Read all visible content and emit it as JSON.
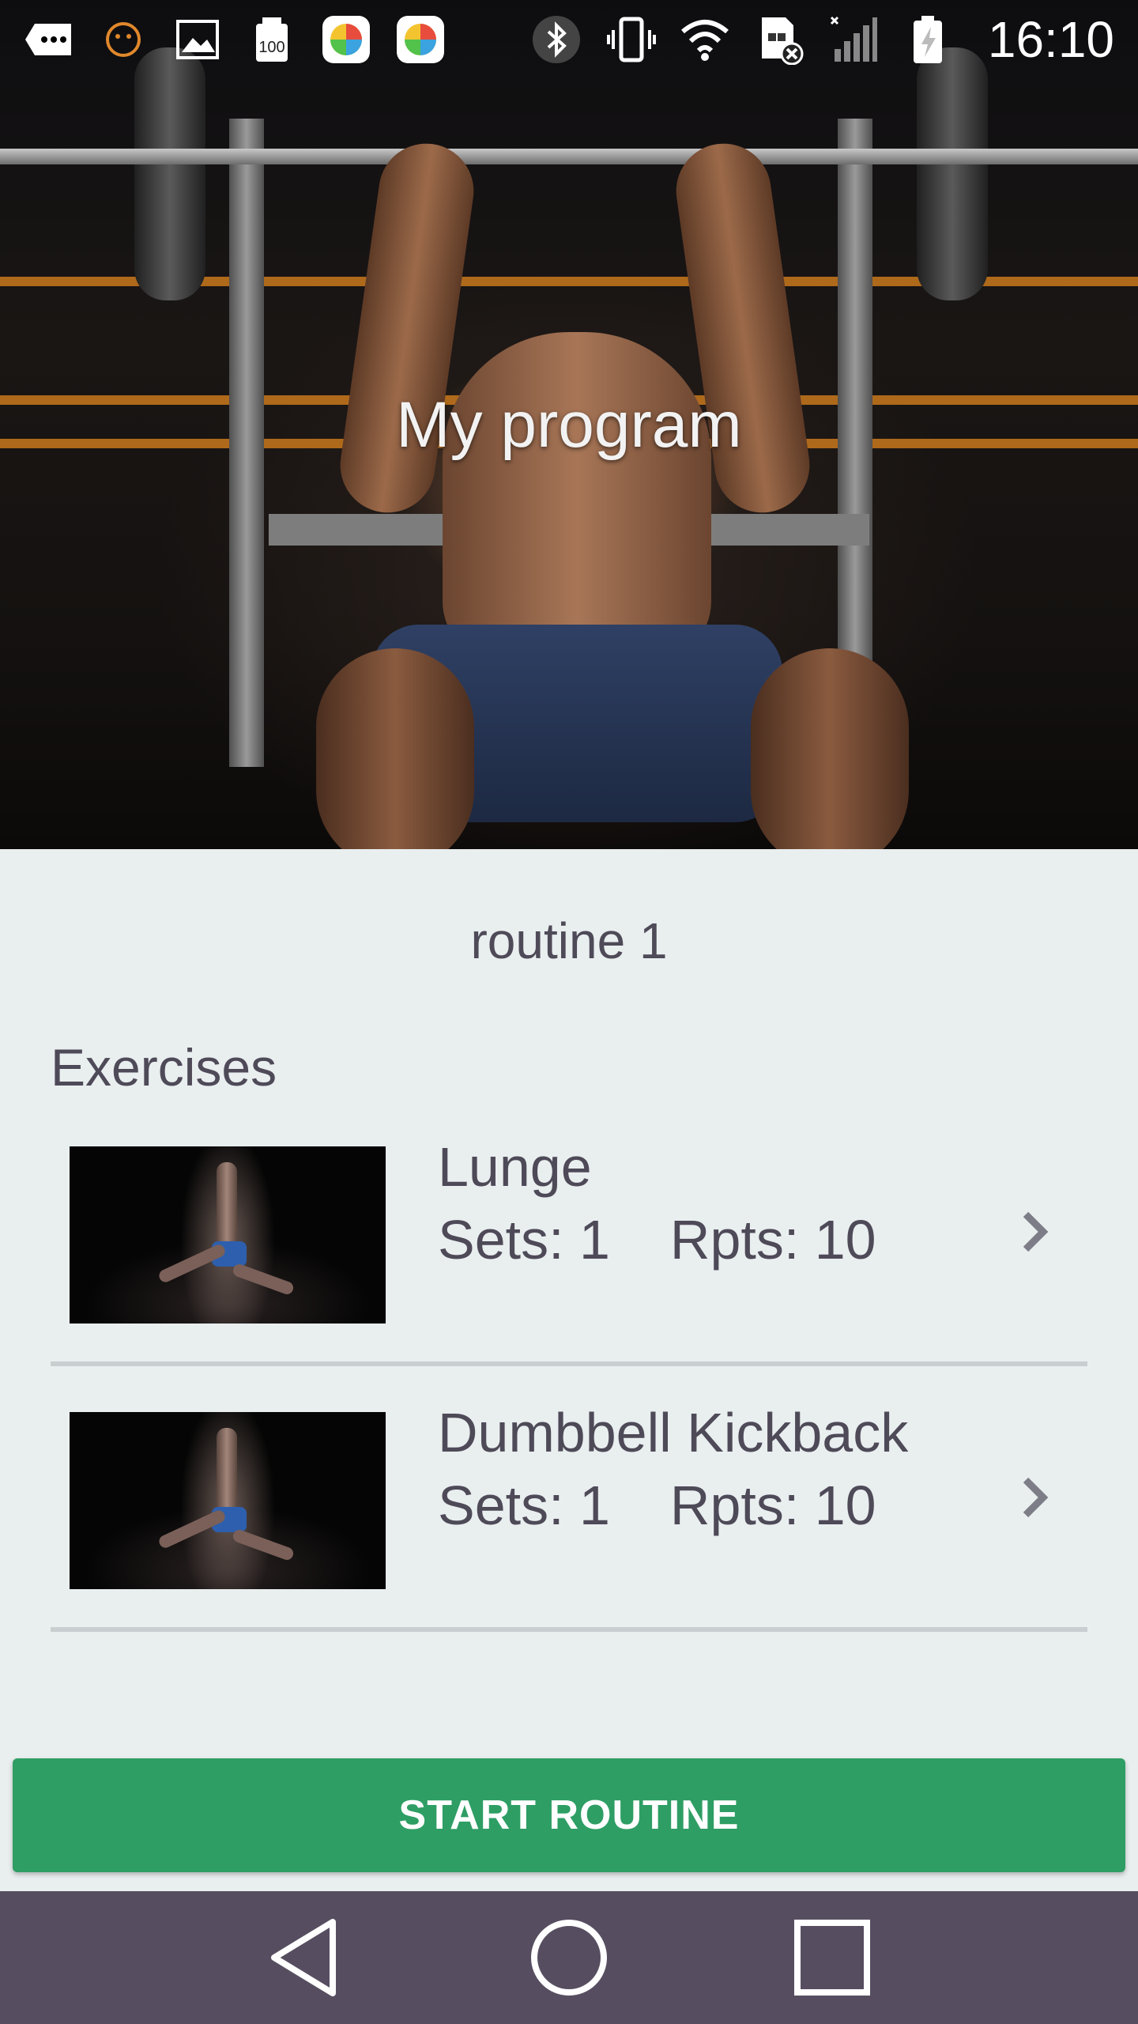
{
  "status_bar": {
    "time": "16:10",
    "left_icons": [
      "message-icon",
      "emoji-icon",
      "gallery-icon",
      "battery-100-icon",
      "app-icon",
      "app-icon"
    ],
    "right_icons": [
      "bluetooth-icon",
      "vibrate-icon",
      "wifi-icon",
      "sim-disabled-icon",
      "signal-icon",
      "battery-charging-icon"
    ]
  },
  "hero": {
    "title": "My program"
  },
  "routine": {
    "title": "routine 1",
    "section_label": "Exercises",
    "exercises": [
      {
        "name": "Lunge",
        "sets": "Sets: 1",
        "rpts": "Rpts: 10"
      },
      {
        "name": "Dumbbell Kickback",
        "sets": "Sets: 1",
        "rpts": "Rpts: 10"
      }
    ]
  },
  "actions": {
    "start_label": "START ROUTINE"
  },
  "colors": {
    "accent": "#2e9e64",
    "background": "#e9eeef",
    "text": "#4e4a58",
    "navbar": "#564e60"
  }
}
